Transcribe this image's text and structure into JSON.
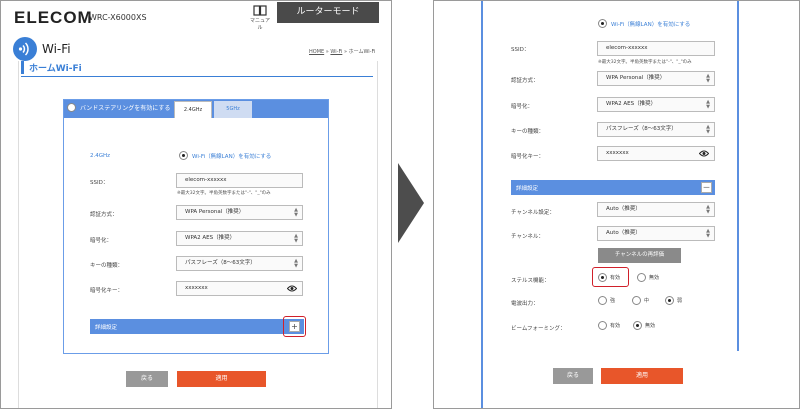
{
  "header": {
    "logo": "ELECOM",
    "model": "WRC-X6000XS",
    "manual_label": "マニュアル",
    "mode_label": "ルーターモード"
  },
  "page": {
    "title": "Wi-Fi",
    "breadcrumb_home": "HOME",
    "breadcrumb_wifi": "Wi-Fi",
    "breadcrumb_sep": " » ",
    "breadcrumb_current": "ホームWi-Fi",
    "section_title": "ホームWi-Fi"
  },
  "form": {
    "band_steering_label": "バンドステアリングを有効にする",
    "tabs": [
      "2.4GHz",
      "5GHz"
    ],
    "band_label": "2.4GHz",
    "wifi_enable_label": "Wi-Fi（無線LAN）を有効にする",
    "ssid_label": "SSID：",
    "ssid_value": "elecom-xxxxxx",
    "ssid_note": "※最大32文字。半角英数字または\"-\"、\"_\"のみ",
    "auth_label": "認証方式：",
    "auth_value": "WPA Personal（推奨）",
    "encryption_label": "暗号化：",
    "encryption_value": "WPA2 AES（推奨）",
    "keytype_label": "キーの種類：",
    "keytype_value": "パスフレーズ（8～63文字）",
    "key_label": "暗号化キー：",
    "key_value": "xxxxxxx",
    "advanced_label": "詳細設定",
    "plus": "+"
  },
  "buttons": {
    "back": "戻る",
    "apply": "適用"
  },
  "right": {
    "wifi_enable_label": "Wi-Fi（無線LAN）を有効にする",
    "ssid_label": "SSID：",
    "ssid_value": "elecom-xxxxxx",
    "ssid_note": "※最大32文字。半角英数字または\"-\"、\"_\"のみ",
    "auth_label": "認証方式：",
    "auth_value": "WPA Personal（推奨）",
    "encryption_label": "暗号化：",
    "encryption_value": "WPA2 AES（推奨）",
    "keytype_label": "キーの種類：",
    "keytype_value": "パスフレーズ（8～63文字）",
    "key_label": "暗号化キー：",
    "key_value": "xxxxxxx",
    "advanced_label": "詳細設定",
    "minus": "－",
    "channel_auto_label": "チャンネル設定：",
    "channel_auto_value": "Auto（推奨）",
    "channel_label": "チャンネル：",
    "channel_value": "Auto（推奨）",
    "channel_button": "チャンネルの再評価",
    "stealth_label": "ステルス機能：",
    "stealth_on": "有効",
    "stealth_off": "無効",
    "power_label": "電波出力：",
    "power_high": "強",
    "power_mid": "中",
    "power_low": "弱",
    "beam_label": "ビームフォーミング：",
    "beam_on": "有効",
    "beam_off": "無効"
  },
  "colors": {
    "accent": "#3a7fd6",
    "bar": "#5b8fe0",
    "apply": "#e8562a",
    "highlight": "#d0202a"
  }
}
